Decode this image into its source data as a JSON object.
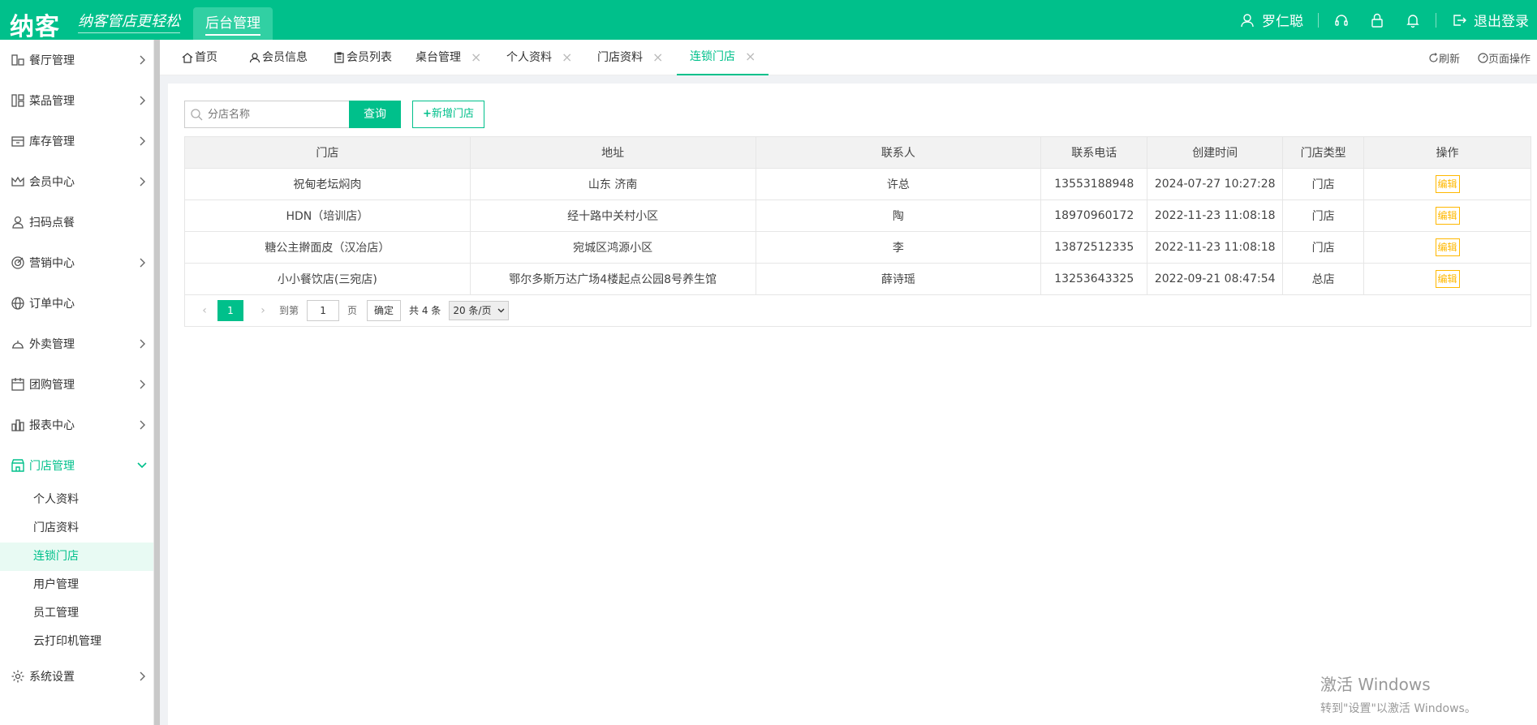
{
  "header": {
    "logo": "纳客",
    "slogan": "纳客管店更轻松",
    "system_button": "后台管理",
    "username": "罗仁聪",
    "logout": "退出登录"
  },
  "sidebar": {
    "items": [
      {
        "label": "餐厅管理",
        "icon": "restaurant-icon"
      },
      {
        "label": "菜品管理",
        "icon": "dishes-icon"
      },
      {
        "label": "库存管理",
        "icon": "inventory-icon"
      },
      {
        "label": "会员中心",
        "icon": "crown-icon"
      },
      {
        "label": "扫码点餐",
        "icon": "user-icon"
      },
      {
        "label": "营销中心",
        "icon": "target-icon"
      },
      {
        "label": "订单中心",
        "icon": "globe-icon"
      },
      {
        "label": "外卖管理",
        "icon": "bell-cloche-icon"
      },
      {
        "label": "团购管理",
        "icon": "calendar-icon"
      },
      {
        "label": "报表中心",
        "icon": "chart-icon"
      },
      {
        "label": "门店管理",
        "icon": "store-icon"
      }
    ],
    "store_submenu": [
      "个人资料",
      "门店资料",
      "连锁门店",
      "用户管理",
      "员工管理",
      "云打印机管理"
    ],
    "settings": "系统设置"
  },
  "tabs": [
    "首页",
    "会员信息",
    "会员列表",
    "桌台管理",
    "个人资料",
    "门店资料",
    "连锁门店"
  ],
  "tab_tools": {
    "refresh": "刷新",
    "page_ops": "页面操作"
  },
  "search": {
    "placeholder": "分店名称",
    "button": "查询",
    "add_button": "新增门店"
  },
  "table": {
    "headers": [
      "门店",
      "地址",
      "联系人",
      "联系电话",
      "创建时间",
      "门店类型",
      "操作"
    ],
    "rows": [
      [
        "祝甸老坛焖肉",
        "山东 济南",
        "许总",
        "13553188948",
        "2024-07-27 10:27:28",
        "门店",
        "编辑"
      ],
      [
        "HDN（培训店）",
        "经十路中关村小区",
        "陶",
        "18970960172",
        "2022-11-23 11:08:18",
        "门店",
        "编辑"
      ],
      [
        "糖公主擀面皮（汉冶店）",
        "宛城区鸿源小区",
        "李",
        "13872512335",
        "2022-11-23 11:08:18",
        "门店",
        "编辑"
      ],
      [
        "小小餐饮店(三宛店)",
        "鄂尔多斯万达广场4楼起点公园8号养生馆",
        "薛诗瑶",
        "13253643325",
        "2022-09-21 08:47:54",
        "总店",
        "编辑"
      ]
    ]
  },
  "pager": {
    "current": "1",
    "goto": "到第",
    "page_input": "1",
    "page_unit": "页",
    "confirm": "确定",
    "total": "共 4 条",
    "page_size": "20 条/页"
  },
  "watermark": {
    "line1": "激活 Windows",
    "line2": "转到\"设置\"以激活 Windows。"
  },
  "colors": {
    "primary": "#00c08b",
    "edit": "#ffb800"
  }
}
